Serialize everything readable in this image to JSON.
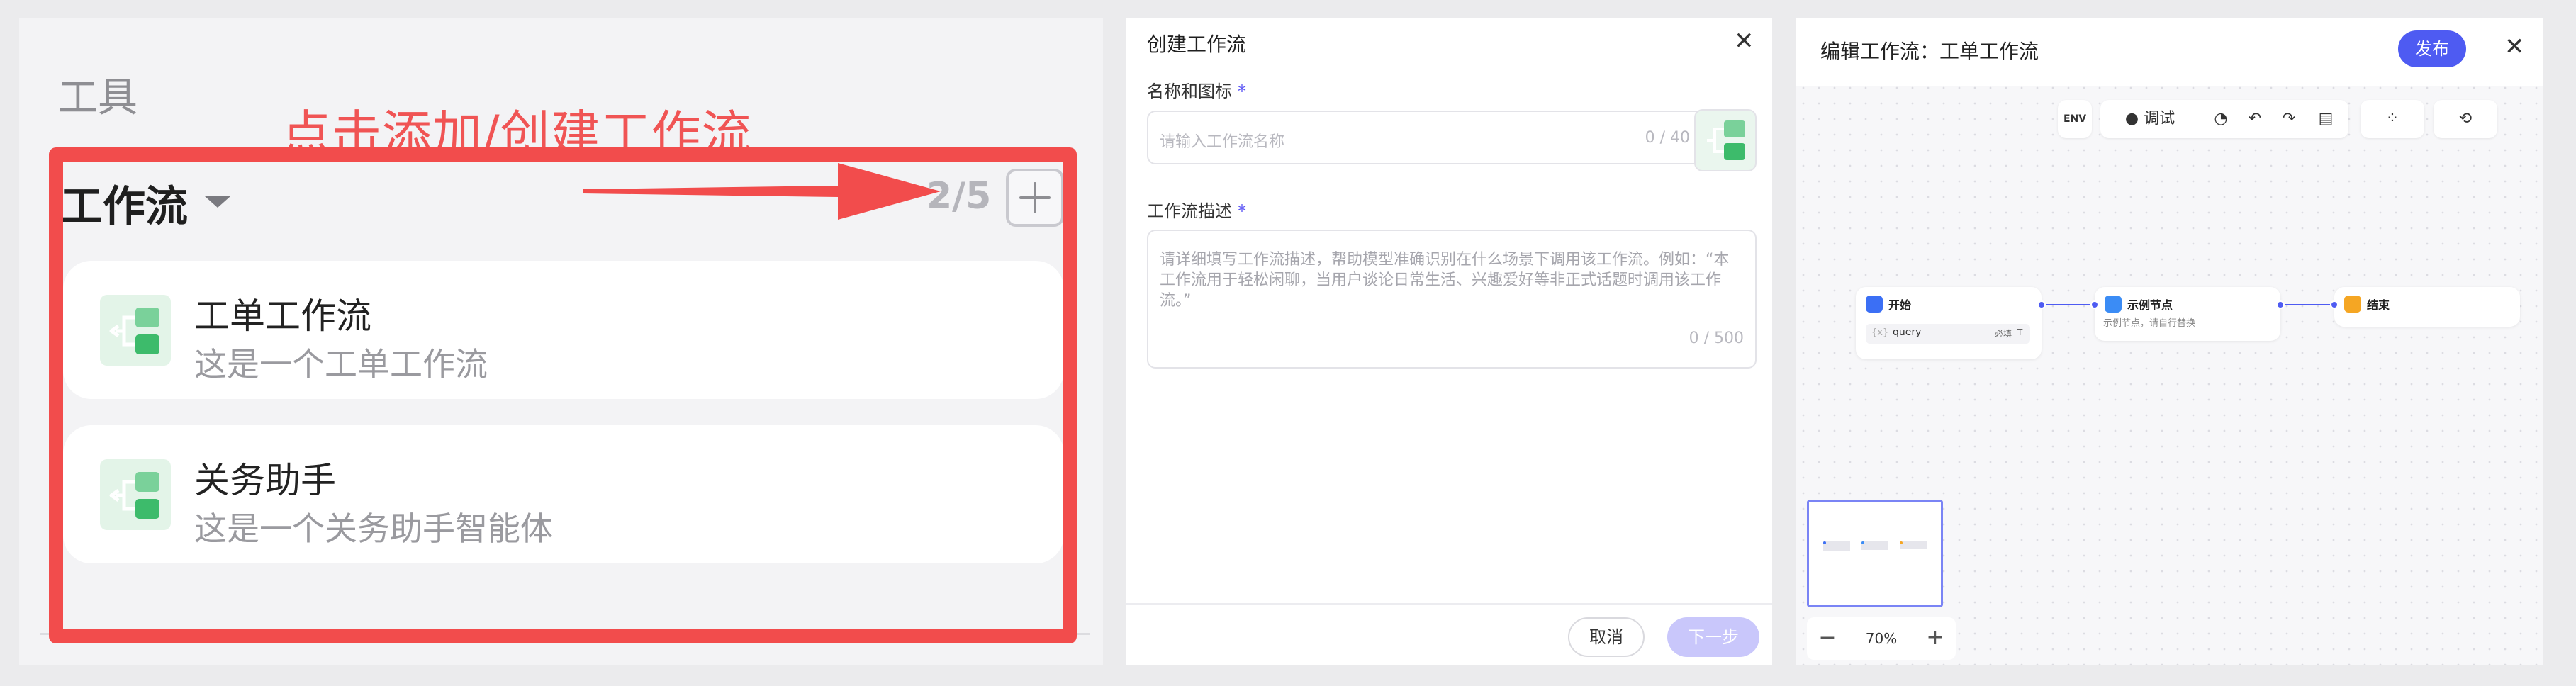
{
  "tools_panel": {
    "section_title": "工具",
    "hint": "点击添加/创建工作流",
    "workflow_heading": "工作流",
    "count": "2/5",
    "items": [
      {
        "name": "工单工作流",
        "desc": "这是一个工单工作流"
      },
      {
        "name": "关务助手",
        "desc": "这是一个关务助手智能体"
      }
    ],
    "colors": {
      "highlight": "#f24c4c",
      "icon_bg": "#e3f4e8",
      "icon_fg": "#3dbb6b"
    }
  },
  "create_dialog": {
    "title": "创建工作流",
    "name_label": "名称和图标",
    "required_mark": "*",
    "name_placeholder": "请输入工作流名称",
    "name_count": "0 / 40",
    "desc_label": "工作流描述",
    "desc_placeholder": "请详细填写工作流描述，帮助模型准确识别在什么场景下调用该工作流。例如：“本工作流用于轻松闲聊，当用户谈论日常生活、兴趣爱好等非正式话题时调用该工作流。”",
    "desc_count": "0 / 500",
    "cancel_label": "取消",
    "next_label": "下一步"
  },
  "editor": {
    "title": "编辑工作流：工单工作流",
    "publish_label": "发布",
    "toolbar": {
      "env_label": "ENV",
      "debug_label": "调试"
    },
    "nodes": {
      "start": {
        "title": "开始",
        "param": "query",
        "required": "必填",
        "type": "T"
      },
      "example": {
        "title": "示例节点",
        "desc": "示例节点，请自行替换"
      },
      "end": {
        "title": "结束"
      }
    },
    "zoom": "70%",
    "colors": {
      "accent": "#4e5bf2",
      "start": "#3b6ff5",
      "example": "#3b8cf5",
      "end": "#f5a623"
    }
  }
}
